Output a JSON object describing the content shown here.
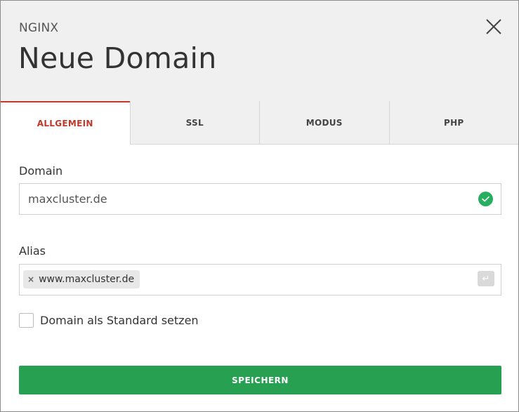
{
  "header": {
    "subtitle": "NGINX",
    "title": "Neue Domain",
    "close_icon": "close-icon"
  },
  "tabs": [
    {
      "label": "ALLGEMEIN",
      "active": true
    },
    {
      "label": "SSL",
      "active": false
    },
    {
      "label": "MODUS",
      "active": false
    },
    {
      "label": "PHP",
      "active": false
    }
  ],
  "domain": {
    "label": "Domain",
    "value": "maxcluster.de",
    "status_icon": "check-circle-icon"
  },
  "alias": {
    "label": "Alias",
    "tags": [
      "www.maxcluster.de"
    ],
    "tag_remove_glyph": "×",
    "enter_glyph": "↵"
  },
  "default_checkbox": {
    "label": "Domain als Standard setzen",
    "checked": false
  },
  "save_button": {
    "label": "SPEICHERN"
  },
  "colors": {
    "accent": "#c0392b",
    "success": "#27a052",
    "header_bg": "#f0f0f0"
  }
}
